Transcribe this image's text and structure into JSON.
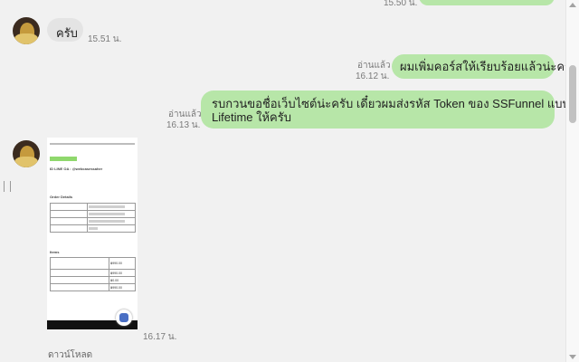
{
  "messages": {
    "top_time": "15.50 น.",
    "incoming_1": {
      "text": "ครับ",
      "time": "15.51 น."
    },
    "outgoing_1": {
      "read": "อ่านแล้ว",
      "time": "16.12 น.",
      "text": "ผมเพิ่มคอร์สให้เรียบร้อยแล้วน่ะครับ"
    },
    "outgoing_2": {
      "read": "อ่านแล้ว",
      "time": "16.13 น.",
      "line1": "รบกวนขอชื่อเว็บไซต์น่ะครับ เดี๋ยวผมส่งรหัส Token ของ SSFunnel แบบ",
      "line2": "Lifetime ให้ครับ"
    },
    "incoming_image": {
      "time": "16.17 น.",
      "download": "ดาวน์โหลด",
      "doc": {
        "line_id": "ID LINE OA : @webcasessaher",
        "order_details": "Order Details",
        "summary_title": "Items",
        "price_1": "฿990.00",
        "price_2": "฿990.00",
        "price_3": "฿0.00",
        "price_4": "฿990.00"
      }
    }
  },
  "colors": {
    "outgoing_bubble": "#b7e6a8",
    "incoming_bubble": "#e4e4e4",
    "background": "#f1f1f1"
  }
}
